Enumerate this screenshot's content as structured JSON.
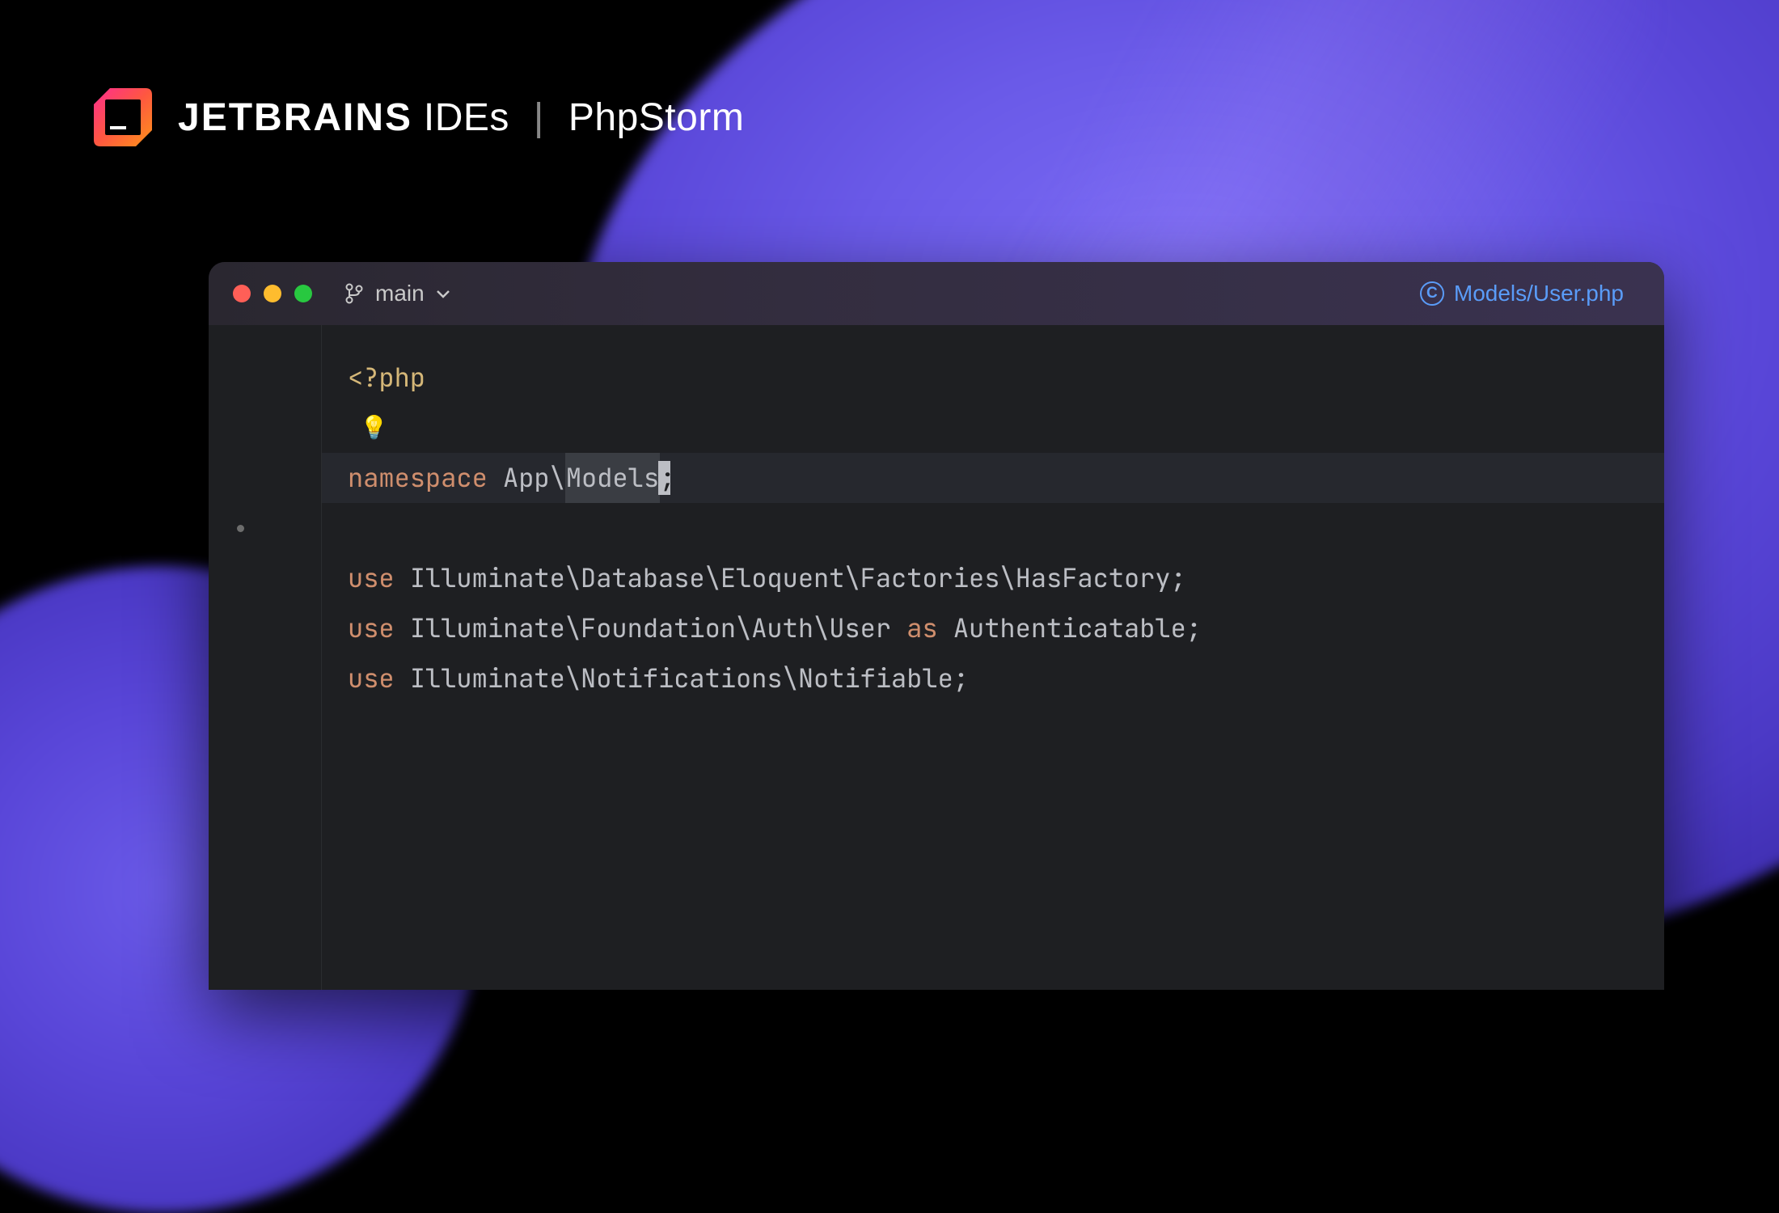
{
  "brand": {
    "name": "JETBRAINS",
    "suffix": "IDEs",
    "product": "PhpStorm"
  },
  "titlebar": {
    "branch": "main",
    "file_path": "Models/User.php"
  },
  "code": {
    "open_tag": "<?php",
    "bulb": "💡",
    "ns_keyword": "namespace",
    "ns_app": "App\\",
    "ns_models": "Models",
    "use_keyword": "use",
    "as_keyword": "as",
    "line1_class": "Illuminate\\Database\\Eloquent\\Factories\\HasFactory",
    "line2_class": "Illuminate\\Foundation\\Auth\\User",
    "line2_alias": "Authenticatable",
    "line3_class": "Illuminate\\Notifications\\Notifiable",
    "semicolon": ";"
  },
  "colors": {
    "accent_purple": "#6a5ae8",
    "link_blue": "#5a9cf8",
    "keyword": "#cf8e6d",
    "tag": "#d5b778"
  }
}
